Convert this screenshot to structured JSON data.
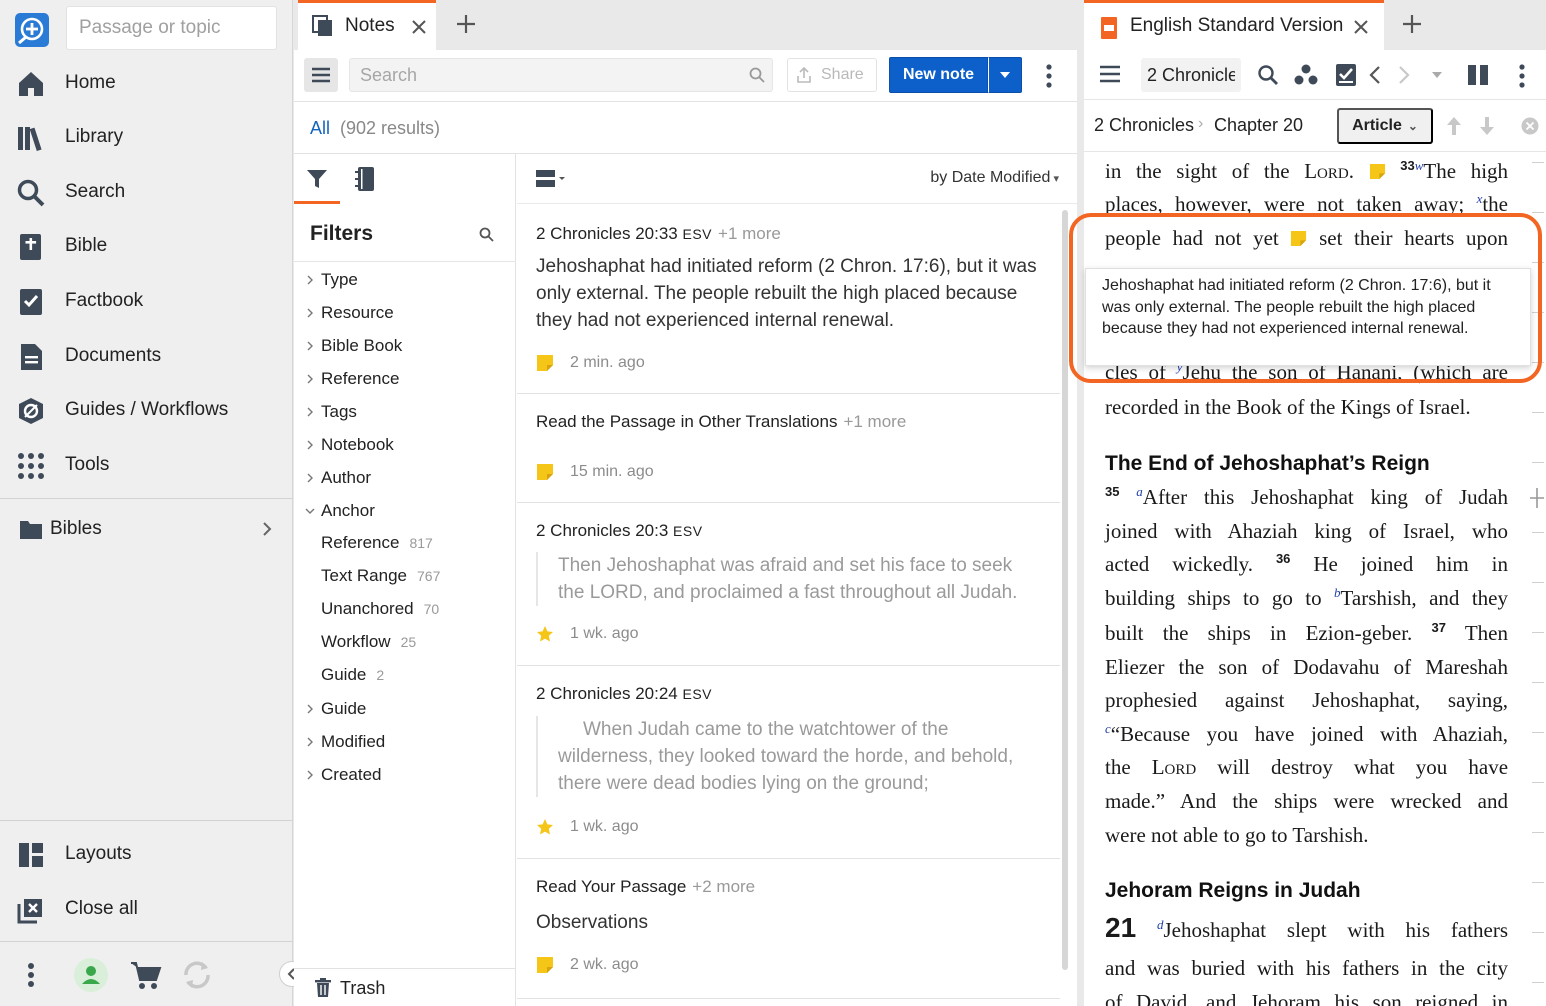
{
  "sidebar": {
    "passage_placeholder": "Passage or topic",
    "nav": [
      {
        "label": "Home",
        "icon": "home-icon"
      },
      {
        "label": "Library",
        "icon": "library-icon"
      },
      {
        "label": "Search",
        "icon": "search-icon"
      },
      {
        "label": "Bible",
        "icon": "bible-icon"
      },
      {
        "label": "Factbook",
        "icon": "factbook-icon"
      },
      {
        "label": "Documents",
        "icon": "documents-icon"
      },
      {
        "label": "Guides / Workflows",
        "icon": "guides-icon"
      },
      {
        "label": "Tools",
        "icon": "tools-icon"
      }
    ],
    "bibles_label": "Bibles",
    "layouts_label": "Layouts",
    "close_all_label": "Close all"
  },
  "notes": {
    "tab_title": "Notes",
    "search_placeholder": "Search",
    "share_label": "Share",
    "new_note_label": "New note",
    "all_label": "All",
    "results_count": "(902 results)",
    "filters_title": "Filters",
    "filters": [
      "Type",
      "Resource",
      "Bible Book",
      "Reference",
      "Tags",
      "Notebook",
      "Author",
      "Anchor"
    ],
    "anchor_sub": [
      {
        "label": "Reference",
        "count": "817"
      },
      {
        "label": "Text Range",
        "count": "767"
      },
      {
        "label": "Unanchored",
        "count": "70"
      },
      {
        "label": "Workflow",
        "count": "25"
      },
      {
        "label": "Guide",
        "count": "2"
      }
    ],
    "filters_after": [
      "Guide",
      "Modified",
      "Created"
    ],
    "trash_label": "Trash",
    "sort_label": "by Date Modified",
    "cards": [
      {
        "ref": "2 Chronicles 20:33",
        "version": "ESV",
        "more": "+1 more",
        "body": "Jehoshaphat had initiated reform (2 Chron. 17:6), but it was only external. The people rebuilt the high placed because they had not experienced internal renewal.",
        "time": "2 min. ago",
        "icon": "sticky-note-icon"
      },
      {
        "ref": "Read the Passage in Other Translations",
        "version": "",
        "more": "+1 more",
        "body": "",
        "time": "15 min. ago",
        "icon": "sticky-note-icon"
      },
      {
        "ref": "2 Chronicles 20:3",
        "version": "ESV",
        "more": "",
        "quote": "Then Jehoshaphat was afraid and set his face to seek the LORD, and proclaimed a fast throughout all Judah.",
        "time": "1 wk. ago",
        "icon": "star-icon"
      },
      {
        "ref": "2 Chronicles 20:24",
        "version": "ESV",
        "more": "",
        "quote": "When Judah came to the watchtower of the wilderness, they looked toward the horde, and behold, there were dead bodies lying on the ground;",
        "time": "1 wk. ago",
        "icon": "star-icon"
      },
      {
        "ref": "Read Your Passage",
        "version": "",
        "more": "+2 more",
        "body": "Observations",
        "time": "2 wk. ago",
        "icon": "sticky-note-icon"
      }
    ]
  },
  "bible": {
    "tab_title": "English Standard Version",
    "ref_value": "2 Chronicle",
    "crumb_book": "2 Chronicles",
    "crumb_sep": "›",
    "crumb_chapter": "Chapter 20",
    "article_label": "Article",
    "heading1": "The End of Jehoshaphat’s Reign",
    "heading2": "Jehoram Reigns in Judah",
    "chapter_num": "21",
    "popup_text": "Jehoshaphat had initiated reform (2 Chron. 17:6), but it was only external. The people rebuilt the high placed because they had not experienced internal renewal."
  },
  "colors": {
    "accent": "#f26522",
    "primary": "#0d5fc9",
    "note_yellow": "#f5c518"
  }
}
